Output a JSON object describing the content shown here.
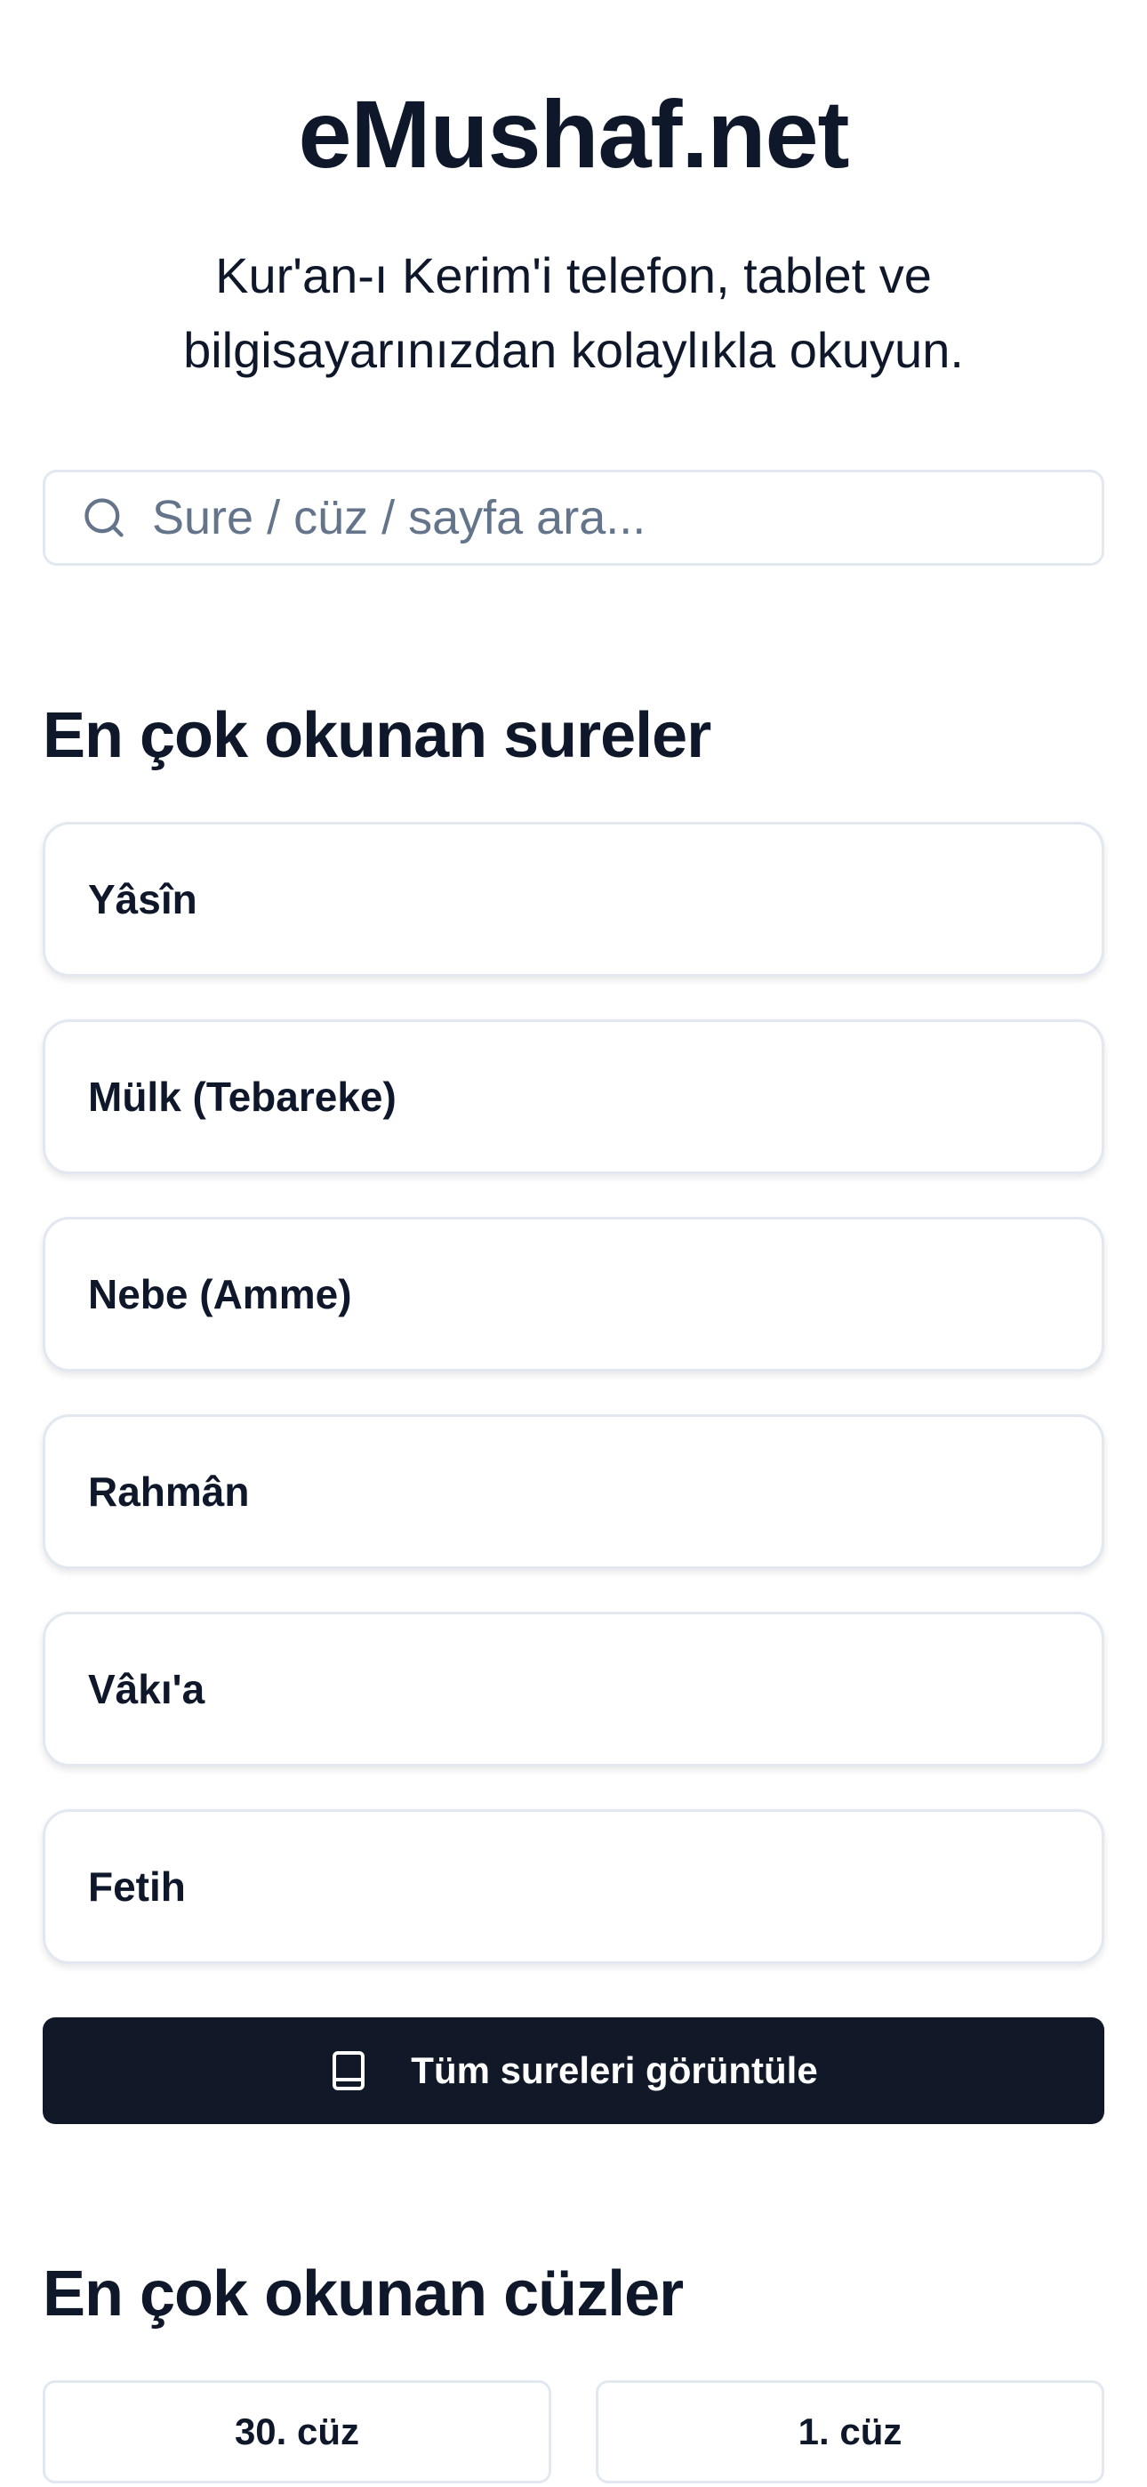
{
  "header": {
    "site_title": "eMushaf.net",
    "tagline_line1": "Kur'an-ı Kerim'i telefon, tablet ve",
    "tagline_line2": "bilgisayarınızdan kolaylıkla okuyun."
  },
  "search": {
    "icon": "search-icon",
    "placeholder": "Sure / cüz / sayfa ara...",
    "value": ""
  },
  "popular_sures": {
    "title": "En çok okunan sureler",
    "items": [
      {
        "label": "Yâsîn"
      },
      {
        "label": "Mülk (Tebareke)"
      },
      {
        "label": "Nebe (Amme)"
      },
      {
        "label": "Rahmân"
      },
      {
        "label": "Vâkı'a"
      },
      {
        "label": "Fetih"
      }
    ],
    "all_button": {
      "icon": "book-icon",
      "label": "Tüm sureleri görüntüle"
    }
  },
  "popular_cuz": {
    "title": "En çok okunan cüzler",
    "items": [
      {
        "label": "30. cüz"
      },
      {
        "label": "1. cüz"
      }
    ]
  },
  "colors": {
    "text": "#0f172a",
    "border": "#e2e8f0",
    "placeholder": "#64748b",
    "button_bg": "#111827",
    "button_text": "#ffffff",
    "background": "#ffffff"
  }
}
